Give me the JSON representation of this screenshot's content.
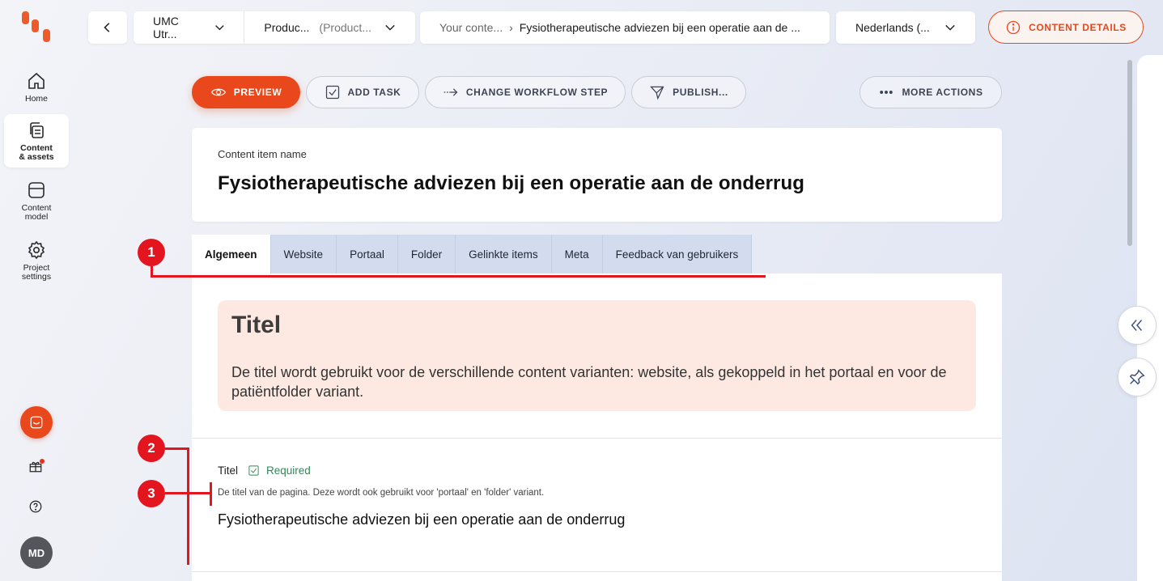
{
  "nav": {
    "items": [
      {
        "label": "Home",
        "icon": "home-icon"
      },
      {
        "label": "Content\n& assets",
        "icon": "content-assets-icon"
      },
      {
        "label": "Content\nmodel",
        "icon": "content-model-icon"
      },
      {
        "label": "Project\nsettings",
        "icon": "gear-icon"
      }
    ],
    "avatar": "MD"
  },
  "topbar": {
    "project": "UMC Utr...",
    "environment": "Produc...",
    "environment_muted": "(Product...",
    "breadcrumb_parent": "Your conte...",
    "breadcrumb_sep": "›",
    "breadcrumb_current": "Fysiotherapeutische adviezen bij een operatie aan de ...",
    "language": "Nederlands (...",
    "details_label": "CONTENT DETAILS"
  },
  "actions": {
    "preview": "PREVIEW",
    "add_task": "ADD TASK",
    "workflow": "CHANGE WORKFLOW STEP",
    "publish": "PUBLISH...",
    "more": "MORE ACTIONS"
  },
  "item": {
    "name_caption": "Content item name",
    "name": "Fysiotherapeutische adviezen bij een operatie aan de onderrug"
  },
  "tabs": [
    "Algemeen",
    "Website",
    "Portaal",
    "Folder",
    "Gelinkte items",
    "Meta",
    "Feedback van gebruikers"
  ],
  "guideline": {
    "title": "Titel",
    "text": "De titel wordt gebruikt voor de verschillende content varianten: website, als gekoppeld in het portaal en voor de patiëntfolder variant."
  },
  "field": {
    "label": "Titel",
    "required": "Required",
    "help": "De titel van de pagina. Deze wordt ook gebruikt voor 'portaal' en 'folder' variant.",
    "value": "Fysiotherapeutische adviezen bij een operatie aan de onderrug"
  },
  "markers": [
    "1",
    "2",
    "3"
  ],
  "colors": {
    "accent": "#e8481c",
    "marker": "#e3151e",
    "required": "#2e8a58",
    "tab_bg": "#d3dcee",
    "guideline_bg": "#fde9e1"
  }
}
